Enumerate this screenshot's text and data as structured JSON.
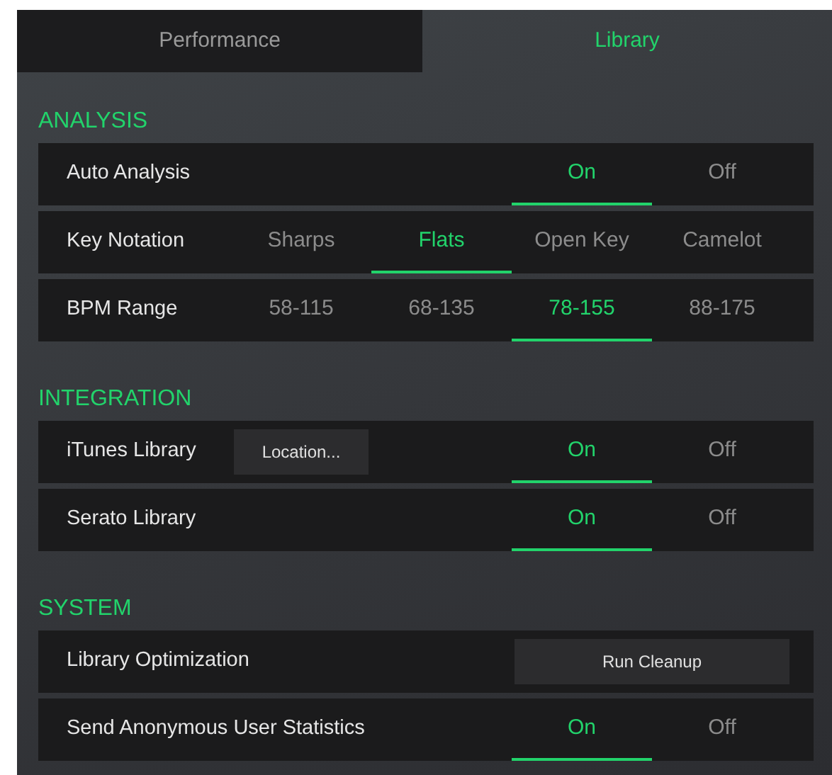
{
  "tabs": [
    {
      "label": "Performance",
      "selected": false
    },
    {
      "label": "Library",
      "selected": true
    }
  ],
  "sections": [
    {
      "title": "ANALYSIS",
      "rows": [
        {
          "kind": "options",
          "label": "Auto Analysis",
          "options": [
            {
              "label": "On",
              "selected": true
            },
            {
              "label": "Off",
              "selected": false
            }
          ]
        },
        {
          "kind": "options",
          "label": "Key Notation",
          "options": [
            {
              "label": "Sharps",
              "selected": false
            },
            {
              "label": "Flats",
              "selected": true
            },
            {
              "label": "Open Key",
              "selected": false
            },
            {
              "label": "Camelot",
              "selected": false
            }
          ]
        },
        {
          "kind": "options",
          "label": "BPM Range",
          "options": [
            {
              "label": "58-115",
              "selected": false
            },
            {
              "label": "68-135",
              "selected": false
            },
            {
              "label": "78-155",
              "selected": true
            },
            {
              "label": "88-175",
              "selected": false
            }
          ]
        }
      ]
    },
    {
      "title": "INTEGRATION",
      "rows": [
        {
          "kind": "options",
          "label": "iTunes Library",
          "button": "Location...",
          "options": [
            {
              "label": "On",
              "selected": true
            },
            {
              "label": "Off",
              "selected": false
            }
          ]
        },
        {
          "kind": "options",
          "label": "Serato Library",
          "options": [
            {
              "label": "On",
              "selected": true
            },
            {
              "label": "Off",
              "selected": false
            }
          ]
        }
      ]
    },
    {
      "title": "SYSTEM",
      "rows": [
        {
          "kind": "action",
          "label": "Library Optimization",
          "button": "Run Cleanup"
        },
        {
          "kind": "options",
          "label": "Send Anonymous User Statistics",
          "options": [
            {
              "label": "On",
              "selected": true
            },
            {
              "label": "Off",
              "selected": false
            }
          ]
        }
      ]
    }
  ]
}
